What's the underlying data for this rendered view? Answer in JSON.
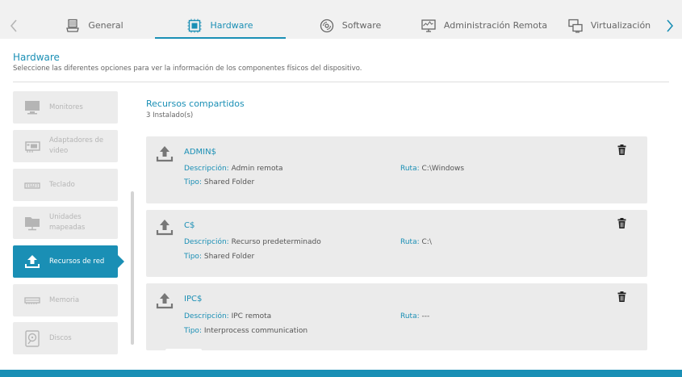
{
  "tabs": {
    "general": "General",
    "hardware": "Hardware",
    "software": "Software",
    "admin": "Administración Remota",
    "virt": "Virtualización"
  },
  "header": {
    "title": "Hardware",
    "subtitle": "Seleccione las diferentes opciones para ver la información de los componentes físicos del dispositivo."
  },
  "sidebar": {
    "items": [
      {
        "label": "Monitores",
        "icon": "monitor-icon"
      },
      {
        "label": "Adaptadores de video",
        "icon": "video-card-icon"
      },
      {
        "label": "Teclado",
        "icon": "keyboard-icon"
      },
      {
        "label": "Unidades mapeadas",
        "icon": "mapped-drive-icon"
      },
      {
        "label": "Recursos de red",
        "icon": "network-share-icon",
        "active": true
      },
      {
        "label": "Memoria",
        "icon": "memory-icon"
      },
      {
        "label": "Discos",
        "icon": "disk-icon"
      }
    ]
  },
  "main": {
    "section_title": "Recursos compartidos",
    "count": "3 Instalado(s)",
    "labels": {
      "desc": "Descripción:",
      "tipo": "Tipo:",
      "ruta": "Ruta:"
    },
    "shares": [
      {
        "name": "ADMIN$",
        "desc": "Admin remota",
        "tipo": "Shared Folder",
        "ruta": "C:\\Windows"
      },
      {
        "name": "C$",
        "desc": "Recurso predeterminado",
        "tipo": "Shared Folder",
        "ruta": "C:\\"
      },
      {
        "name": "IPC$",
        "desc": "IPC remota",
        "tipo": "Interprocess communication",
        "ruta": "---"
      }
    ]
  },
  "colors": {
    "accent": "#1a8fb5",
    "card_bg": "#ebebeb",
    "muted": "#b5b5b5"
  }
}
